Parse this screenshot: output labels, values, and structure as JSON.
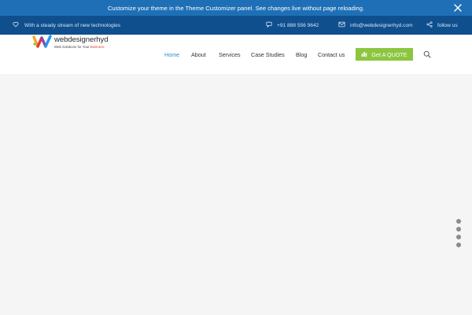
{
  "notice_bar": {
    "message": "Customize your theme in the Theme Customizer panel. See changes live without page reloading.",
    "close_icon": "close-icon"
  },
  "top_strip": {
    "tagline": "With a steady stream of new technologies",
    "phone": "+91 888 556 9642",
    "email": "info@webdesignerhyd.com",
    "follow": "follow us"
  },
  "logo": {
    "text": "webdesignerhyd",
    "subtext_prefix": "Web Solutions for Your ",
    "subtext_highlight": "Business"
  },
  "nav": {
    "items": [
      "Home",
      "About",
      "Services",
      "Case Studies",
      "Blog",
      "Contact us"
    ],
    "active": "Home",
    "cta": "Get A QUOTE"
  },
  "colors": {
    "notice_bg": "#1e6fb6",
    "top_strip_bg": "#0f4f8e",
    "active_link": "#2a93c8",
    "cta_bg": "#8cc63f"
  },
  "slider": {
    "dots": 4
  }
}
